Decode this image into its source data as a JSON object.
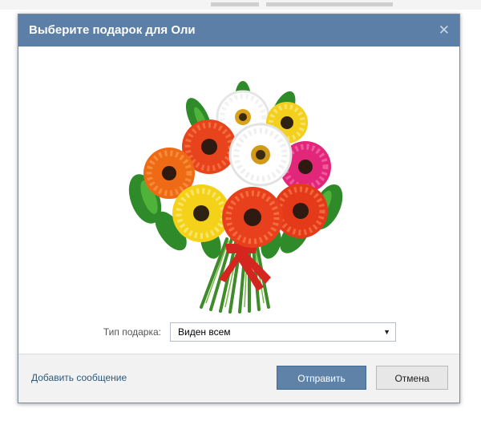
{
  "dialog": {
    "title": "Выберите подарок для Оли",
    "close_glyph": "✕",
    "gift_image": "flower-bouquet-icon"
  },
  "gift_type": {
    "label": "Тип подарка:",
    "selected": "Виден всем",
    "arrow_glyph": "▼"
  },
  "footer": {
    "add_message": "Добавить сообщение",
    "send_label": "Отправить",
    "cancel_label": "Отмена"
  },
  "colors": {
    "header": "#5b7fa6",
    "primary_button": "#5e82a8",
    "link": "#2b587a"
  }
}
